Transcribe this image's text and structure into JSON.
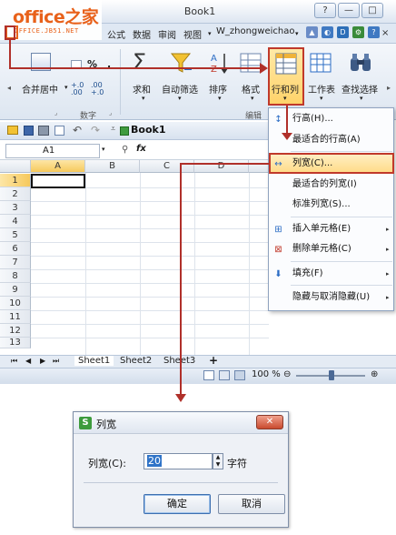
{
  "logo": {
    "main": "office之家",
    "sub": "OFFICE.JB51.NET"
  },
  "window": {
    "title": "Book1",
    "controls": [
      "?",
      "—",
      "□",
      "✕"
    ]
  },
  "menubar": {
    "items": [
      "公式",
      "数据",
      "审阅",
      "视图"
    ],
    "user": "W_zhongweichao"
  },
  "ribbon": {
    "merge_label": "合并居中",
    "number_group": "数字",
    "sum_label": "求和",
    "filter_label": "自动筛选",
    "sort_label": "排序",
    "format_label": "格式",
    "rowcol_label": "行和列",
    "sheet_label": "工作表",
    "find_label": "查找选择",
    "edit_group": "编辑",
    "percent": "%",
    "dec_inc": "+.0\n.00",
    "dec_dec": ".00\n+.0"
  },
  "workbook": {
    "tab_title": "Book1",
    "namebox": "A1",
    "fx": "fx",
    "columns": [
      "A",
      "B",
      "C",
      "D"
    ],
    "rows": [
      "1",
      "2",
      "3",
      "4",
      "5",
      "6",
      "7",
      "8",
      "9",
      "10",
      "11",
      "12",
      "13"
    ],
    "sheets": [
      "Sheet1",
      "Sheet2",
      "Sheet3"
    ],
    "zoom": "100 %"
  },
  "dropdown": {
    "items": [
      {
        "label": "行高(H)...",
        "icon": "row-height-icon"
      },
      {
        "label": "最适合的行高(A)"
      },
      {
        "label": "列宽(C)...",
        "icon": "column-width-icon",
        "highlighted": true
      },
      {
        "label": "最适合的列宽(I)"
      },
      {
        "label": "标准列宽(S)..."
      },
      {
        "label": "插入单元格(E)",
        "icon": "insert-cells-icon",
        "submenu": true
      },
      {
        "label": "删除单元格(C)",
        "icon": "delete-cells-icon",
        "submenu": true
      },
      {
        "label": "填充(F)",
        "icon": "fill-icon",
        "submenu": true
      },
      {
        "label": "隐藏与取消隐藏(U)",
        "submenu": true
      }
    ]
  },
  "dialog": {
    "title": "列宽",
    "field_label": "列宽(C):",
    "value": "20",
    "unit": "字符",
    "ok": "确定",
    "cancel": "取消"
  },
  "colors": {
    "accent": "#c0392b",
    "highlight": "#ffd36b",
    "selection": "#3074c8"
  }
}
